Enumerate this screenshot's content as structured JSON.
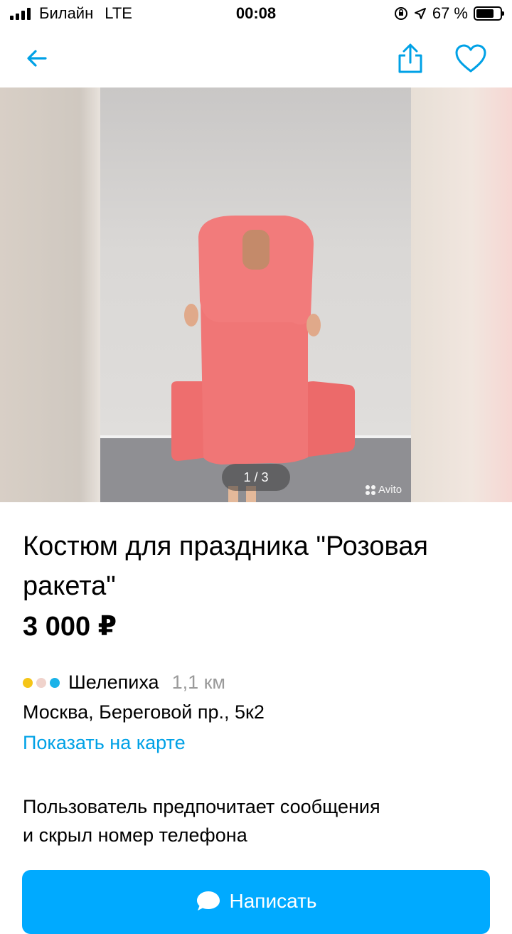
{
  "status_bar": {
    "carrier": "Билайн",
    "network": "LTE",
    "time": "00:08",
    "battery": "67 %",
    "battery_level": 0.67,
    "icons": [
      "signal-icon",
      "orientation-lock-icon",
      "location-arrow-icon",
      "battery-icon"
    ]
  },
  "nav": {
    "icons": [
      "back-arrow-icon",
      "share-icon",
      "heart-icon"
    ],
    "accent_color": "#00a1e6"
  },
  "gallery": {
    "counter": "1 / 3",
    "current": 1,
    "total": 3,
    "watermark": "Avito"
  },
  "listing": {
    "title": "Костюм для праздника \"Розовая ракета\"",
    "price": "3 000 ₽",
    "metro": {
      "station": "Шелепиха",
      "distance": "1,1 км",
      "line_colors": [
        "#f5c518",
        "#f0d3cc",
        "#1ab2e8"
      ]
    },
    "address": "Москва, Береговой пр., 5к2",
    "map_link": "Показать на карте",
    "contact_note_line1": "Пользователь предпочитает сообщения",
    "contact_note_line2": "и скрыл номер телефона",
    "write_button": "Написать",
    "button_color": "#00aaff"
  }
}
